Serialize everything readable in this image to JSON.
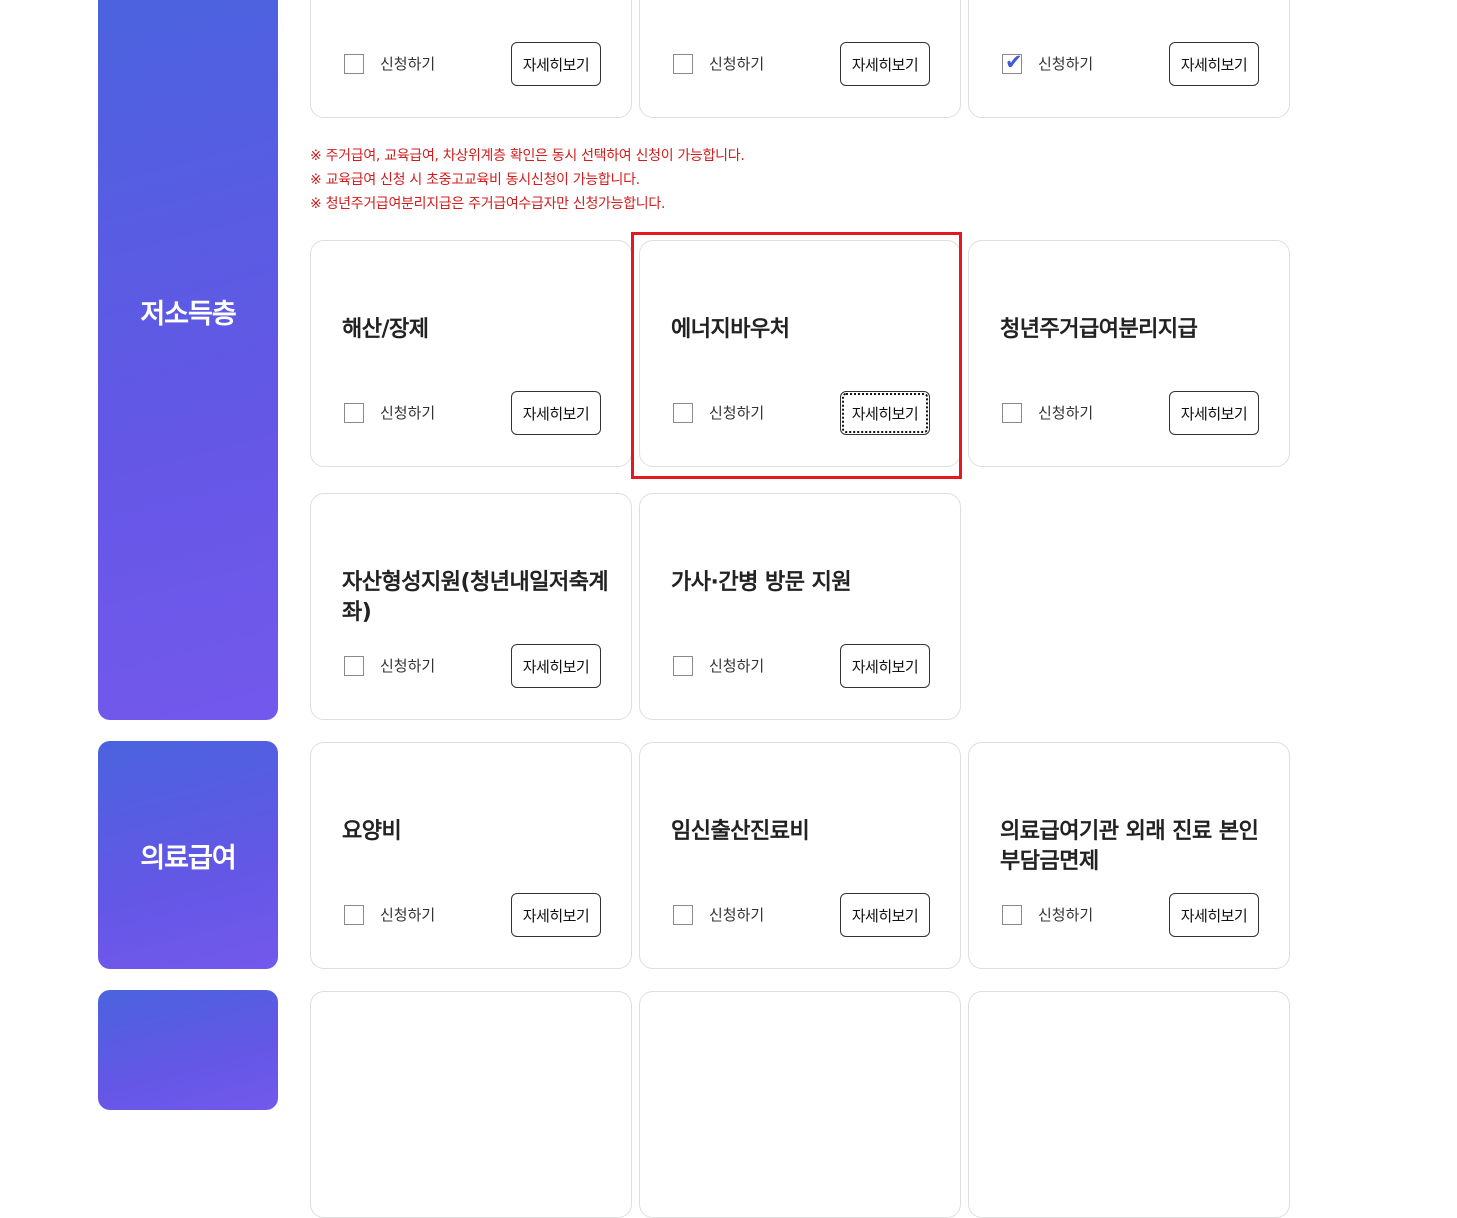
{
  "common": {
    "apply_label": "신청하기",
    "detail_label": "자세히보기"
  },
  "top_row": [
    {
      "checked": false
    },
    {
      "checked": false
    },
    {
      "checked": true
    }
  ],
  "notes": [
    "※ 주거급여, 교육급여, 차상위계층 확인은 동시 선택하여 신청이 가능합니다.",
    "※ 교육급여 신청 시 초중고교육비 동시신청이 가능합니다.",
    "※ 청년주거급여분리지급은 주거급여수급자만 신청가능합니다."
  ],
  "categories": [
    {
      "label": "저소득층",
      "cards": [
        {
          "title": "해산/장제",
          "checked": false
        },
        {
          "title": "에너지바우처",
          "checked": false
        },
        {
          "title": "청년주거급여분리지급",
          "checked": false
        },
        {
          "title": "자산형성지원(청년내일저축계좌)",
          "checked": false
        },
        {
          "title": "가사·간병 방문 지원",
          "checked": false
        }
      ]
    },
    {
      "label": "의료급여",
      "cards": [
        {
          "title": "요양비",
          "checked": false
        },
        {
          "title": "임신출산진료비",
          "checked": false
        },
        {
          "title": "의료급여기관 외래 진료 본인부담금면제",
          "checked": false
        }
      ]
    },
    {
      "label": "",
      "cards": [
        {
          "title": "",
          "checked": false
        },
        {
          "title": "",
          "checked": false
        },
        {
          "title": "",
          "checked": false
        }
      ]
    }
  ],
  "highlight": {
    "color": "#e3191f"
  },
  "colors": {
    "accent": "#5a5ee2",
    "note": "#d21d1d"
  }
}
